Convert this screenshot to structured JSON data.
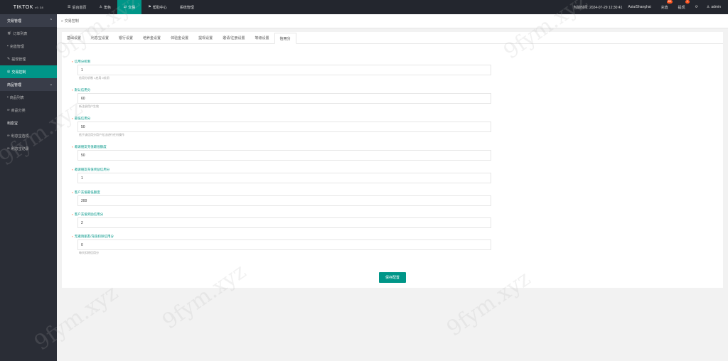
{
  "app": {
    "logo": "TIKTOK",
    "logo_version": "v9.38"
  },
  "topnav": [
    {
      "label": "后台首页",
      "icon": "menu-icon"
    },
    {
      "label": "角色",
      "icon": "user-icon"
    },
    {
      "label": "交易",
      "icon": "exchange-icon",
      "active": true
    },
    {
      "label": "帮助中心",
      "icon": "flag-icon"
    },
    {
      "label": "系统管理",
      "icon": ""
    }
  ],
  "topright": {
    "time_label": "当前时间: 2024-07-29 12:30:41",
    "timezone": "Asia/Shanghai",
    "recharge": "充值",
    "recharge_badge": "66",
    "withdraw": "提现",
    "withdraw_badge": "1",
    "user": "admin"
  },
  "sidebar": {
    "groups": [
      {
        "label": "交易管理",
        "items": [
          {
            "label": "订单列表",
            "icon": "cart-icon"
          },
          {
            "label": "充值管理",
            "icon": "chat-icon"
          },
          {
            "label": "提现管理",
            "icon": "wrench-icon"
          },
          {
            "label": "交易控制",
            "icon": "circle-icon",
            "active": true
          }
        ]
      },
      {
        "label": "商品管理",
        "items": [
          {
            "label": "商品列表",
            "icon": "cart-icon"
          },
          {
            "label": "商品分类",
            "icon": "link-icon"
          }
        ]
      },
      {
        "label": "利息宝",
        "items": [
          {
            "label": "利息宝选项",
            "icon": "link-icon"
          },
          {
            "label": "利息宝记录",
            "icon": "link-icon"
          }
        ]
      }
    ]
  },
  "breadcrumb": "交易控制",
  "tabs": [
    "基础设置",
    "利息宝设置",
    "银行设置",
    "培养金设置",
    "体验金设置",
    "提现设置",
    "邀请/注册设置",
    "等级设置",
    "信用分"
  ],
  "active_tab": 8,
  "form": {
    "fields": [
      {
        "label": "信用分机制",
        "value": "1",
        "help": "信用分机制 1启用 0关闭"
      },
      {
        "label": "默认信用分",
        "value": "60",
        "help": "新注册用户生效"
      },
      {
        "label": "最低信用分",
        "value": "50",
        "help": "低于该信用分用户无法进行任何操作"
      },
      {
        "label": "邀请朋友充值最低额度",
        "value": "50",
        "help": ""
      },
      {
        "label": "邀请朋友充值奖励信用分",
        "value": "1",
        "help": ""
      },
      {
        "label": "客户充值最低额度",
        "value": "200",
        "help": ""
      },
      {
        "label": "客户充值奖励信用分",
        "value": "2",
        "help": ""
      },
      {
        "label": "无邀请朋友/充值扣除信用分",
        "value": "0",
        "help": "每天扣除信用分"
      }
    ],
    "save_label": "保存配置"
  },
  "watermark_text": "9fym.xyz"
}
